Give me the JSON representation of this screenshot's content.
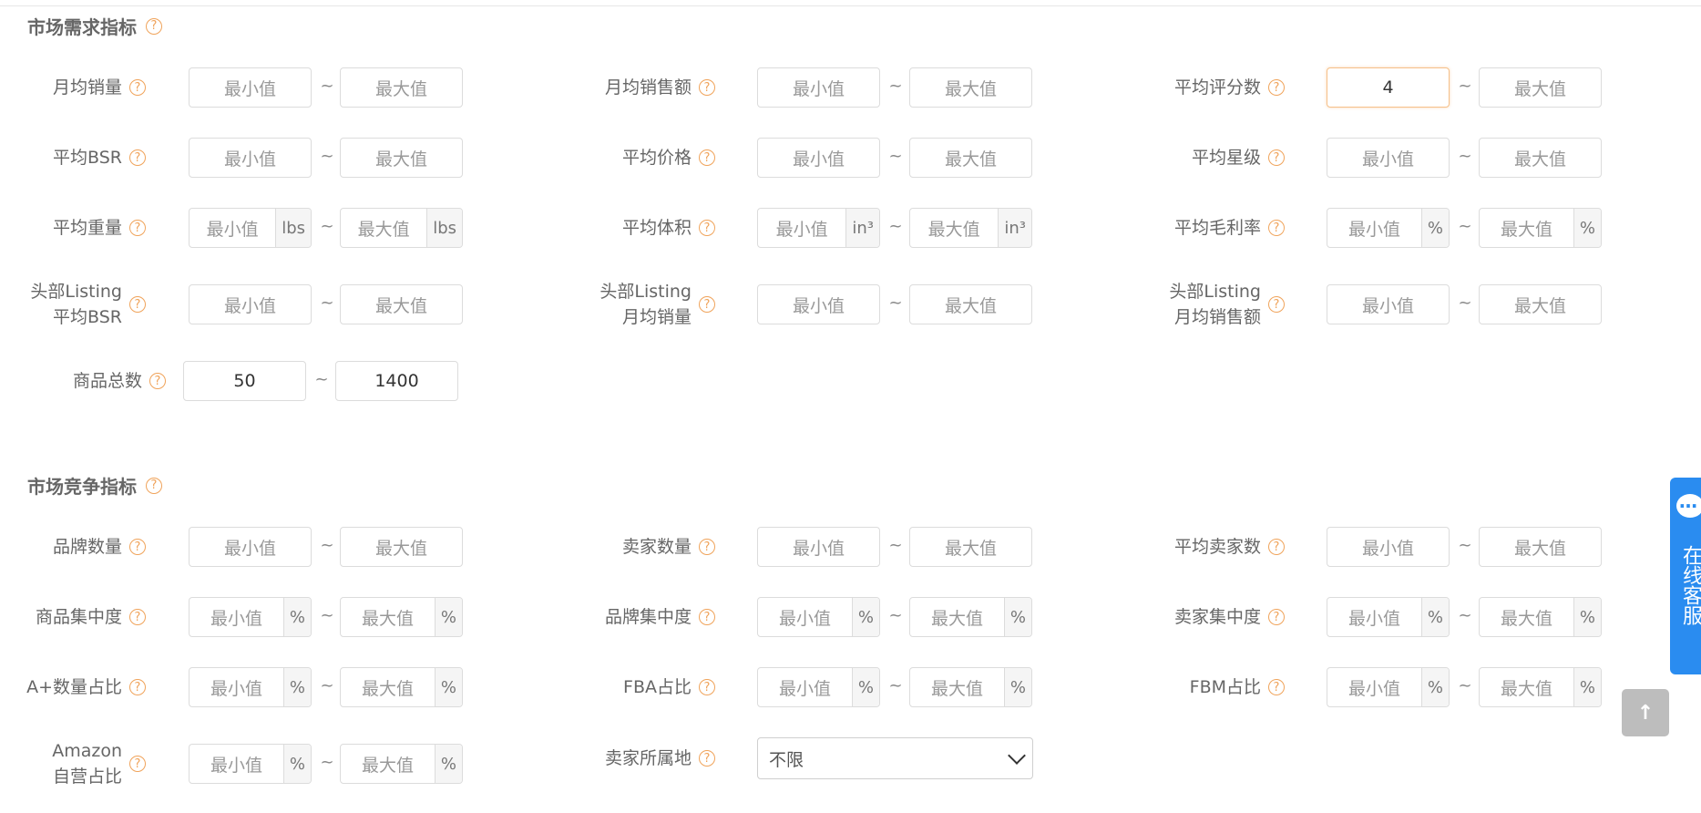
{
  "demand": {
    "title": "市场需求指标",
    "rows": [
      [
        {
          "label": [
            "月均销量"
          ],
          "min": "最小值",
          "max": "最大值",
          "unit": ""
        },
        {
          "label": [
            "月均销售额"
          ],
          "min": "最小值",
          "max": "最大值",
          "unit": ""
        },
        {
          "label": [
            "平均评分数"
          ],
          "min": "4",
          "min_filled": true,
          "min_focused": true,
          "max": "最大值",
          "unit": ""
        }
      ],
      [
        {
          "label": [
            "平均BSR"
          ],
          "min": "最小值",
          "max": "最大值",
          "unit": ""
        },
        {
          "label": [
            "平均价格"
          ],
          "min": "最小值",
          "max": "最大值",
          "unit": ""
        },
        {
          "label": [
            "平均星级"
          ],
          "min": "最小值",
          "max": "最大值",
          "unit": ""
        }
      ],
      [
        {
          "label": [
            "平均重量"
          ],
          "min": "最小值",
          "max": "最大值",
          "unit": "lbs"
        },
        {
          "label": [
            "平均体积"
          ],
          "min": "最小值",
          "max": "最大值",
          "unit": "in³"
        },
        {
          "label": [
            "平均毛利率"
          ],
          "min": "最小值",
          "max": "最大值",
          "unit": "%"
        }
      ],
      [
        {
          "label": [
            "头部Listing",
            "平均BSR"
          ],
          "min": "最小值",
          "max": "最大值",
          "unit": ""
        },
        {
          "label": [
            "头部Listing",
            "月均销量"
          ],
          "min": "最小值",
          "max": "最大值",
          "unit": ""
        },
        {
          "label": [
            "头部Listing",
            "月均销售额"
          ],
          "min": "最小值",
          "max": "最大值",
          "unit": ""
        }
      ]
    ],
    "total": {
      "label": "商品总数",
      "min": "50",
      "max": "1400"
    }
  },
  "competition": {
    "title": "市场竞争指标",
    "rows": [
      [
        {
          "label": [
            "品牌数量"
          ],
          "min": "最小值",
          "max": "最大值",
          "unit": ""
        },
        {
          "label": [
            "卖家数量"
          ],
          "min": "最小值",
          "max": "最大值",
          "unit": ""
        },
        {
          "label": [
            "平均卖家数"
          ],
          "min": "最小值",
          "max": "最大值",
          "unit": ""
        }
      ],
      [
        {
          "label": [
            "商品集中度"
          ],
          "min": "最小值",
          "max": "最大值",
          "unit": "%"
        },
        {
          "label": [
            "品牌集中度"
          ],
          "min": "最小值",
          "max": "最大值",
          "unit": "%"
        },
        {
          "label": [
            "卖家集中度"
          ],
          "min": "最小值",
          "max": "最大值",
          "unit": "%"
        }
      ],
      [
        {
          "label": [
            "A+数量占比"
          ],
          "min": "最小值",
          "max": "最大值",
          "unit": "%"
        },
        {
          "label": [
            "FBA占比"
          ],
          "min": "最小值",
          "max": "最大值",
          "unit": "%"
        },
        {
          "label": [
            "FBM占比"
          ],
          "min": "最小值",
          "max": "最大值",
          "unit": "%"
        }
      ]
    ],
    "amazon_self": {
      "label": [
        "Amazon",
        "自营占比"
      ],
      "min": "最小值",
      "max": "最大值",
      "unit": "%"
    },
    "seller_location": {
      "label": "卖家所属地",
      "value": "不限"
    }
  },
  "help_glyph": "?",
  "tilde": "~",
  "service": {
    "text": "在线客服",
    "icon": "chat-bubble-icon"
  },
  "scroll_top": {
    "icon": "arrow-up-icon",
    "glyph": "↑"
  },
  "colors": {
    "help": "#f0a35a",
    "service": "#2a8cf0",
    "focus": "#f6c089"
  }
}
